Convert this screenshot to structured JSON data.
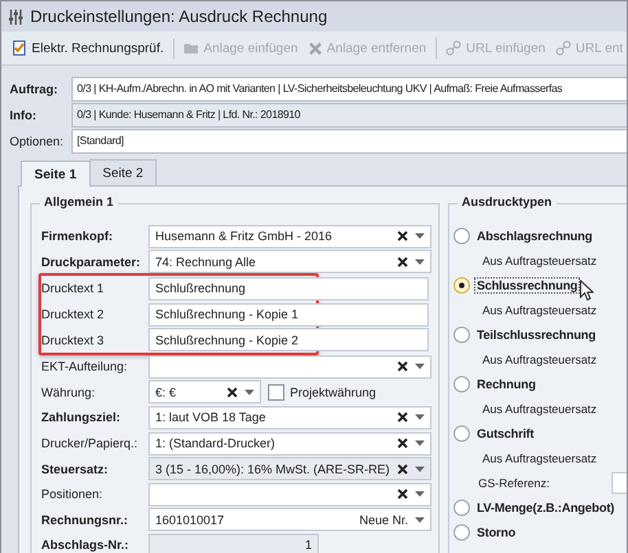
{
  "window": {
    "title": "Druckeinstellungen: Ausdruck Rechnung"
  },
  "toolbar": [
    {
      "label": "Elektr. Rechnungsprüf.",
      "disabled": false,
      "divider_before": false
    },
    {
      "label": "Anlage einfügen",
      "disabled": true,
      "divider_before": true
    },
    {
      "label": "Anlage entfernen",
      "disabled": true,
      "divider_before": false
    },
    {
      "label": "URL einfügen",
      "disabled": true,
      "divider_before": true
    },
    {
      "label": "URL ent",
      "disabled": true,
      "divider_before": false
    }
  ],
  "header_fields": [
    {
      "label": "Auftrag:",
      "value": "0/3 | KH-Aufm./Abrechn. in AO mit Varianten | LV-Sicherheitsbeleuchtung UKV | Aufmaß: Freie Aufmasserfas",
      "bold": true,
      "readonly": false
    },
    {
      "label": "Info:",
      "value": "0/3 | Kunde: Husemann & Fritz | Lfd. Nr.: 2018910",
      "bold": true,
      "readonly": true
    },
    {
      "label": "Optionen:",
      "value": "[Standard]",
      "bold": false,
      "readonly": false
    }
  ],
  "tabs": [
    {
      "label": "Seite 1",
      "selected": true
    },
    {
      "label": "Seite 2",
      "selected": false
    }
  ],
  "general": {
    "title": "Allgemein 1",
    "rows": [
      {
        "label": "Firmenkopf:",
        "bold": true,
        "kind": "combo",
        "value": "Husemann & Fritz GmbH - 2016",
        "highlighted": false,
        "readonly": false
      },
      {
        "label": "Druckparameter:",
        "bold": true,
        "kind": "combo",
        "value": "74: Rechnung Alle",
        "highlighted": false,
        "readonly": false
      },
      {
        "label": "Drucktext 1",
        "bold": false,
        "kind": "text",
        "value": "Schlußrechnung",
        "highlighted": true,
        "readonly": false
      },
      {
        "label": "Drucktext 2",
        "bold": false,
        "kind": "text",
        "value": "Schlußrechnung - Kopie 1",
        "highlighted": true,
        "readonly": false
      },
      {
        "label": "Drucktext 3",
        "bold": false,
        "kind": "text",
        "value": "Schlußrechnung - Kopie 2",
        "highlighted": true,
        "readonly": false
      },
      {
        "label": "EKT-Aufteilung:",
        "bold": false,
        "kind": "combo",
        "highlighted": false,
        "readonly": false
      },
      {
        "label": "Währung:",
        "bold": false,
        "kind": "currency",
        "value": "€: €",
        "checkbox_label": "Projektwährung",
        "checked": false,
        "highlighted": false,
        "readonly": false
      },
      {
        "label": "Zahlungsziel:",
        "bold": true,
        "kind": "combo",
        "value": "1: laut  VOB  18 Tage",
        "highlighted": false,
        "readonly": false
      },
      {
        "label": "Drucker/Papierq.:",
        "bold": false,
        "kind": "combo",
        "value": "1: (Standard-Drucker)",
        "highlighted": false,
        "readonly": false
      },
      {
        "label": "Steuersatz:",
        "bold": true,
        "kind": "combo",
        "value": "3 (15 - 16,00%): 16% MwSt. (ARE-SR-RE)",
        "highlighted": false,
        "readonly": true
      },
      {
        "label": "Positionen:",
        "bold": false,
        "kind": "combo",
        "highlighted": false,
        "readonly": false
      },
      {
        "label": "Rechnungsnr.:",
        "bold": true,
        "kind": "number",
        "value": "1601010017",
        "button": "Neue Nr.",
        "highlighted": false,
        "readonly": false
      },
      {
        "label": "Abschlags-Nr.:",
        "bold": true,
        "kind": "counter",
        "value": "1",
        "highlighted": false,
        "readonly": true
      }
    ]
  },
  "print_types": {
    "title": "Ausdrucktypen",
    "options": [
      {
        "label": "Abschlagsrechnung",
        "selected": false,
        "notes": [
          {
            "kind": "note",
            "text": "Aus Auftragsteuersatz"
          }
        ]
      },
      {
        "label": "Schlussrechnung",
        "selected": true,
        "notes": [
          {
            "kind": "note",
            "text": "Aus Auftragsteuersatz"
          }
        ]
      },
      {
        "label": "Teilschlussrechnung",
        "selected": false,
        "notes": [
          {
            "kind": "note",
            "text": "Aus Auftragsteuersatz"
          }
        ]
      },
      {
        "label": "Rechnung",
        "selected": false,
        "notes": [
          {
            "kind": "note",
            "text": "Aus Auftragsteuersatz"
          }
        ]
      },
      {
        "label": "Gutschrift",
        "selected": false,
        "notes": [
          {
            "kind": "note",
            "text": "Aus Auftragsteuersatz"
          },
          {
            "kind": "field",
            "text": "GS-Referenz:"
          }
        ]
      },
      {
        "label": "LV-Menge(z.B.:Angebot)",
        "selected": false
      },
      {
        "label": "Storno",
        "selected": false
      }
    ]
  }
}
